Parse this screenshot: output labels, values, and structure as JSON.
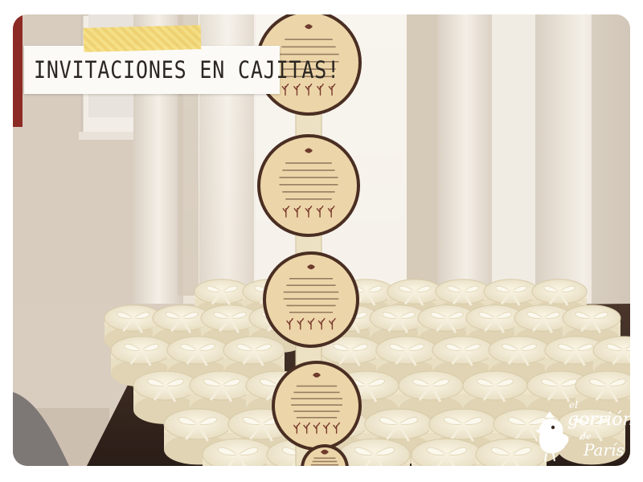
{
  "title": "INVITACIONES EN CAJITAS!",
  "logo": {
    "line1": "el",
    "line2": "gorrión",
    "line3": "de",
    "line4": "París"
  },
  "colors": {
    "card_border": "#4a2e22",
    "card_fill": "#ead4a8",
    "box": "#f1ead2",
    "ribbon": "#f7f2e3",
    "curtain": "#e7dfd2",
    "wall": "#e4d8cb",
    "table": "#3b2a22",
    "banner_tape": "#f3d87a"
  },
  "icons": [
    "bird-icon",
    "ribbon-bow-icon"
  ]
}
